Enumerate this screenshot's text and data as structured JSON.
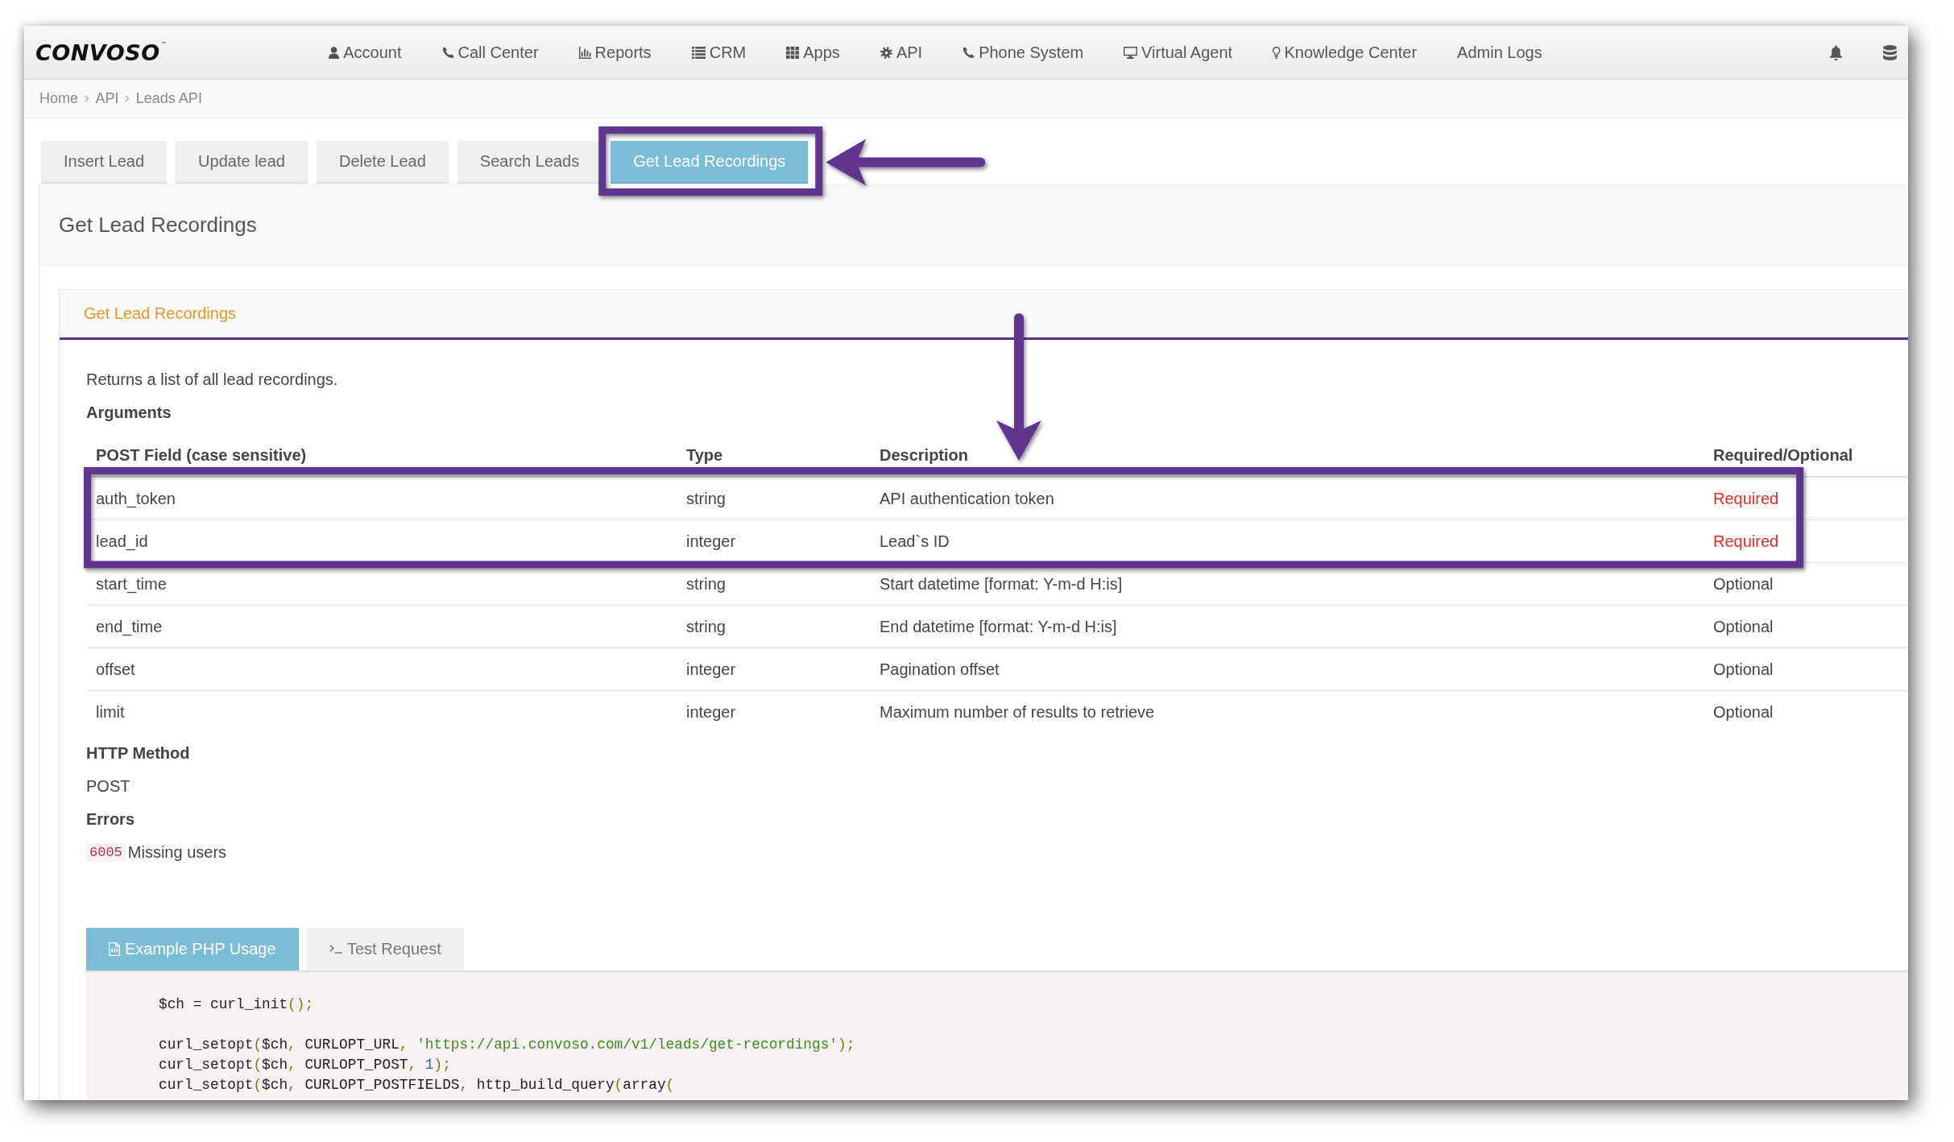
{
  "logo": {
    "name": "CONVOSO",
    "mark": "™"
  },
  "nav": {
    "items": [
      {
        "label": "Account"
      },
      {
        "label": "Call Center"
      },
      {
        "label": "Reports"
      },
      {
        "label": "CRM"
      },
      {
        "label": "Apps"
      },
      {
        "label": "API"
      },
      {
        "label": "Phone System"
      },
      {
        "label": "Virtual Agent"
      },
      {
        "label": "Knowledge Center"
      },
      {
        "label": "Admin Logs"
      }
    ]
  },
  "breadcrumb": [
    "Home",
    "API",
    "Leads API"
  ],
  "tabs": [
    {
      "label": "Insert Lead",
      "selected": false
    },
    {
      "label": "Update lead",
      "selected": false
    },
    {
      "label": "Delete Lead",
      "selected": false
    },
    {
      "label": "Search Leads",
      "selected": false
    },
    {
      "label": "Get Lead Recordings",
      "selected": true
    }
  ],
  "page_title": "Get Lead Recordings",
  "card": {
    "title": "Get Lead Recordings",
    "intro": "Returns a list of all lead recordings.",
    "arguments_heading": "Arguments",
    "table": {
      "columns": [
        "POST Field (case sensitive)",
        "Type",
        "Description",
        "Required/Optional"
      ],
      "rows": [
        {
          "field": "auth_token",
          "type": "string",
          "description": "API authentication token",
          "requirement": "Required",
          "required": true
        },
        {
          "field": "lead_id",
          "type": "integer",
          "description": "Lead`s ID",
          "requirement": "Required",
          "required": true
        },
        {
          "field": "start_time",
          "type": "string",
          "description": "Start datetime [format: Y-m-d H:is]",
          "requirement": "Optional",
          "required": false
        },
        {
          "field": "end_time",
          "type": "string",
          "description": "End datetime [format: Y-m-d H:is]",
          "requirement": "Optional",
          "required": false
        },
        {
          "field": "offset",
          "type": "integer",
          "description": "Pagination offset",
          "requirement": "Optional",
          "required": false
        },
        {
          "field": "limit",
          "type": "integer",
          "description": "Maximum number of results to retrieve",
          "requirement": "Optional",
          "required": false
        }
      ]
    },
    "method_heading": "HTTP Method",
    "method": "POST",
    "errors_heading": "Errors",
    "errors": [
      {
        "code": "6005",
        "message": "Missing users"
      }
    ]
  },
  "code_tabs": [
    {
      "label": "Example PHP Usage",
      "selected": true
    },
    {
      "label": "Test Request",
      "selected": false
    }
  ],
  "code": {
    "blocks": [
      {
        "lines": [
          {
            "tokens": [
              {
                "text": "$ch = curl_init",
                "kind": "plain"
              },
              {
                "text": "();",
                "kind": "punct"
              }
            ]
          }
        ]
      },
      {
        "lines": [
          {
            "tokens": [
              {
                "text": "curl_setopt",
                "kind": "plain"
              },
              {
                "text": "(",
                "kind": "punct"
              },
              {
                "text": "$ch",
                "kind": "plain"
              },
              {
                "text": ",",
                "kind": "punct"
              },
              {
                "text": " CURLOPT_URL",
                "kind": "plain"
              },
              {
                "text": ", ",
                "kind": "punct"
              },
              {
                "text": "'https://api.convoso.com/v1/leads/get-recordings'",
                "kind": "string"
              },
              {
                "text": ");",
                "kind": "punct"
              }
            ]
          },
          {
            "tokens": [
              {
                "text": "curl_setopt",
                "kind": "plain"
              },
              {
                "text": "(",
                "kind": "punct"
              },
              {
                "text": "$ch",
                "kind": "plain"
              },
              {
                "text": ",",
                "kind": "punct"
              },
              {
                "text": " CURLOPT_POST",
                "kind": "plain"
              },
              {
                "text": ", ",
                "kind": "punct"
              },
              {
                "text": "1",
                "kind": "number"
              },
              {
                "text": ");",
                "kind": "punct"
              }
            ]
          },
          {
            "tokens": [
              {
                "text": "curl_setopt",
                "kind": "plain"
              },
              {
                "text": "(",
                "kind": "punct"
              },
              {
                "text": "$ch",
                "kind": "plain"
              },
              {
                "text": ",",
                "kind": "punct"
              },
              {
                "text": " CURLOPT_POSTFIELDS",
                "kind": "plain"
              },
              {
                "text": ",",
                "kind": "punct"
              },
              {
                "text": " http_build_query",
                "kind": "plain"
              },
              {
                "text": "(",
                "kind": "punct"
              },
              {
                "text": "array",
                "kind": "plain"
              },
              {
                "text": "(",
                "kind": "punct"
              }
            ]
          }
        ]
      }
    ]
  }
}
